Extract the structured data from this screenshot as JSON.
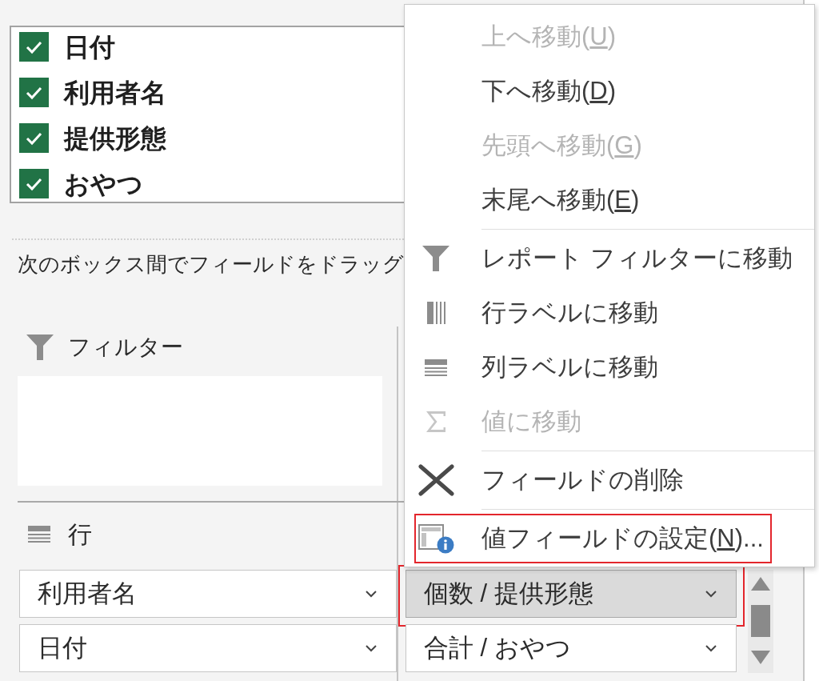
{
  "field_list": {
    "fields": [
      {
        "name": "日付",
        "checked": true
      },
      {
        "name": "利用者名",
        "checked": true
      },
      {
        "name": "提供形態",
        "checked": true
      },
      {
        "name": "おやつ",
        "checked": true
      }
    ]
  },
  "instruction": "次のボックス間でフィールドをドラッグ",
  "areas": {
    "filters": {
      "title": "フィルター"
    },
    "rows": {
      "title": "行",
      "fields": [
        {
          "name": "利用者名"
        },
        {
          "name": "日付"
        }
      ]
    },
    "values": {
      "fields": [
        {
          "name": "個数 / 提供形態",
          "selected": true,
          "highlighted": true
        },
        {
          "name": "合計 / おやつ",
          "selected": false,
          "highlighted": false
        }
      ]
    }
  },
  "context_menu": {
    "sections": [
      {
        "items": [
          {
            "kind": "move",
            "label": "上へ移動(",
            "access_key": "U",
            "label_end": ")",
            "disabled": true,
            "highlighted": false
          },
          {
            "kind": "move",
            "label": "下へ移動(",
            "access_key": "D",
            "label_end": ")",
            "disabled": false,
            "highlighted": false
          },
          {
            "kind": "move",
            "label": "先頭へ移動(",
            "access_key": "G",
            "label_end": ")",
            "disabled": true,
            "highlighted": false
          },
          {
            "kind": "move",
            "label": "末尾へ移動(",
            "access_key": "E",
            "label_end": ")",
            "disabled": false,
            "highlighted": false
          }
        ]
      },
      {
        "items": [
          {
            "kind": "filter",
            "label": "レポート フィルターに移動",
            "disabled": false,
            "highlighted": false
          },
          {
            "kind": "rows",
            "label": "行ラベルに移動",
            "disabled": false,
            "highlighted": false
          },
          {
            "kind": "columns",
            "label": "列ラベルに移動",
            "disabled": false,
            "highlighted": false
          },
          {
            "kind": "values",
            "label": "値に移動",
            "disabled": true,
            "highlighted": false
          }
        ]
      },
      {
        "items": [
          {
            "kind": "remove",
            "label": "フィールドの削除",
            "disabled": false,
            "highlighted": false
          }
        ]
      },
      {
        "items": [
          {
            "kind": "settings",
            "label": "値フィールドの設定(",
            "access_key": "N",
            "label_end": ")...",
            "disabled": false,
            "highlighted": true
          }
        ]
      }
    ]
  }
}
